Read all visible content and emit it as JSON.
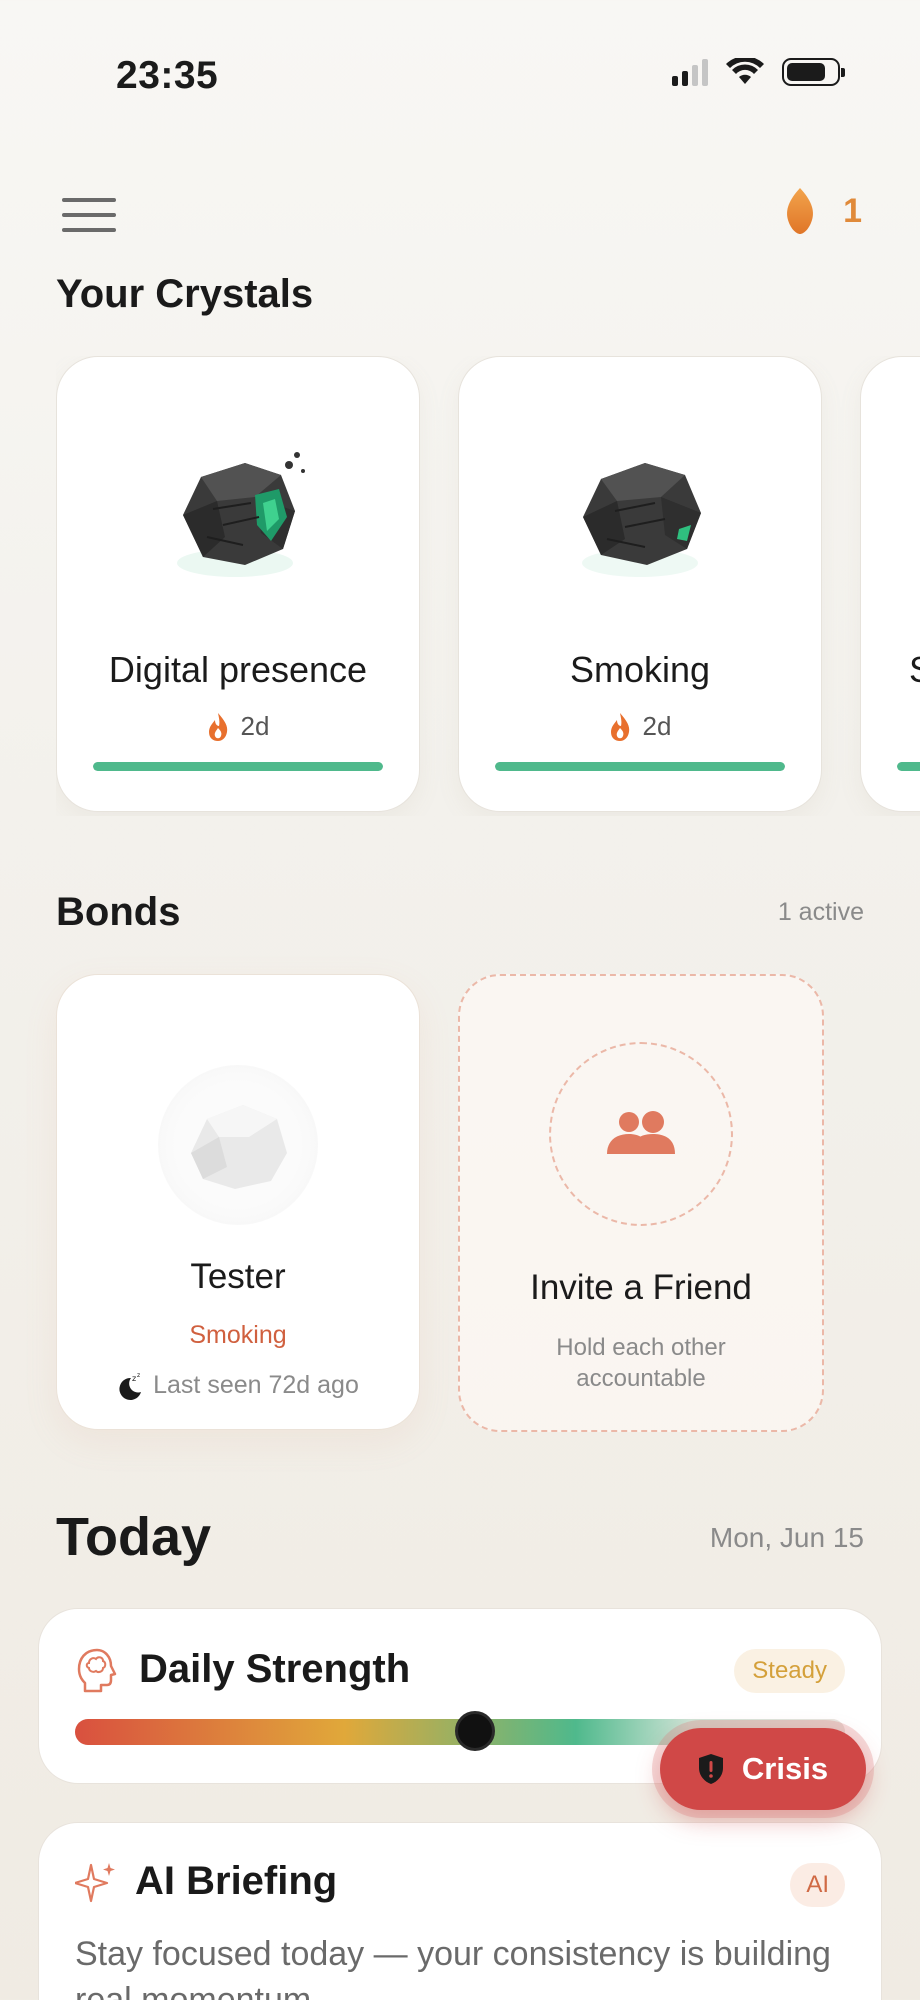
{
  "status_bar": {
    "time": "23:35"
  },
  "header": {
    "ember_count": "1"
  },
  "crystals": {
    "title": "Your Crystals",
    "items": [
      {
        "name": "Digital presence",
        "streak": "2d",
        "progress": 1.0,
        "crystal": "dark-rock-green-veins-cracked"
      },
      {
        "name": "Smoking",
        "streak": "2d",
        "progress": 1.0,
        "crystal": "dark-rock-small-green"
      },
      {
        "name": "S",
        "streak": "",
        "progress": 1.0,
        "crystal": "partial"
      }
    ]
  },
  "bonds": {
    "title": "Bonds",
    "active_label": "1 active",
    "friend": {
      "name": "Tester",
      "habit": "Smoking",
      "last_seen": "Last seen 72d ago"
    },
    "invite": {
      "title": "Invite a Friend",
      "subtitle": "Hold each other accountable"
    }
  },
  "today": {
    "title": "Today",
    "date": "Mon, Jun 15",
    "strength": {
      "title": "Daily Strength",
      "badge": "Steady",
      "level": 0.52
    },
    "briefing": {
      "title": "AI Briefing",
      "badge": "AI",
      "text": "Stay focused today — your consistency is building real momentum."
    }
  },
  "crisis": {
    "label": "Crisis"
  },
  "colors": {
    "accent_orange": "#e08a3a",
    "progress_green": "#4fb98c",
    "crisis_red": "#d04847",
    "habit_red": "#d0603f"
  }
}
